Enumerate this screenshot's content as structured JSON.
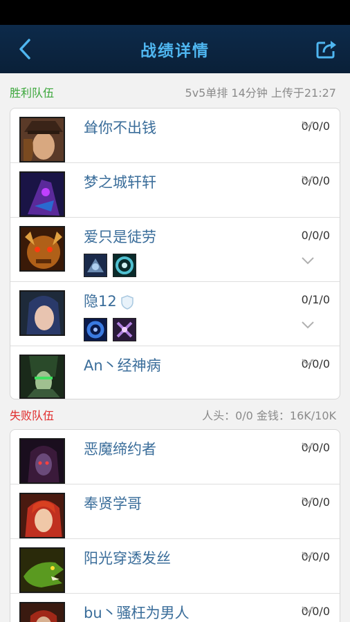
{
  "header": {
    "title": "战绩详情"
  },
  "win": {
    "team": "胜利队伍",
    "meta": "5v5单排   14分钟   上传于21:27",
    "players": [
      {
        "name": "耸你不出钱",
        "kda": "0/0/0"
      },
      {
        "name": "梦之城轩轩",
        "kda": "0/0/0"
      },
      {
        "name": "爱只是徒劳",
        "kda": "0/0/0"
      },
      {
        "name": "隐12",
        "kda": "0/1/0"
      },
      {
        "name": "An丶经神病",
        "kda": "0/0/0"
      }
    ]
  },
  "lose": {
    "team": "失败队伍",
    "meta": "人头：0/0   金钱：16K/10K",
    "players": [
      {
        "name": "恶魔缔约者",
        "kda": "0/0/0"
      },
      {
        "name": "奉贤学哥",
        "kda": "0/0/0"
      },
      {
        "name": "阳光穿透发丝",
        "kda": "0/0/0"
      },
      {
        "name": "bu丶骚枉为男人",
        "kda": "0/0/0"
      }
    ]
  },
  "colors": {
    "win": "#3aa63a",
    "lose": "#e02a2a",
    "accent": "#4fb6f0",
    "name": "#3a6d9a"
  },
  "icons": [
    "back-icon",
    "share-icon",
    "chevron-down-icon",
    "shield-icon"
  ]
}
